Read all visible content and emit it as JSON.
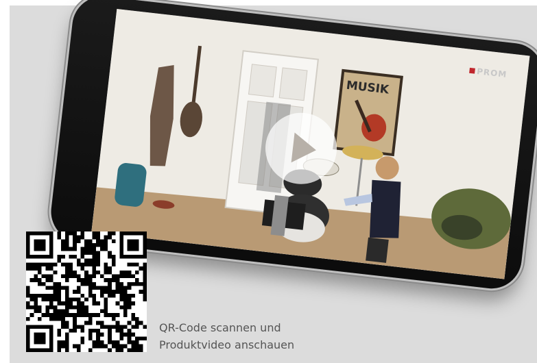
{
  "video": {
    "brand": "PROM",
    "poster_text": "MUSIK",
    "play_label": "Play"
  },
  "qr": {
    "caption_line1": "QR-Code scannen und",
    "caption_line2": "Produktvideo anschauen"
  },
  "colors": {
    "background": "#dcdcdc",
    "phone_body": "#111111",
    "brand_red": "#c0272d",
    "caption_text": "#555555"
  }
}
